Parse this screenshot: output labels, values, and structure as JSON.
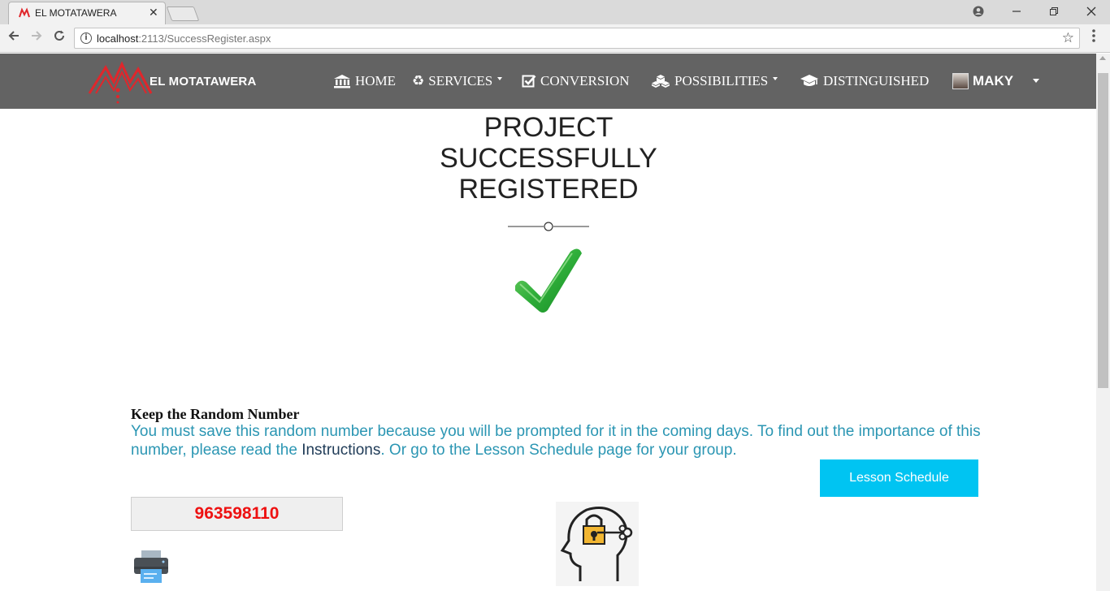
{
  "browser": {
    "tab_title": "EL MOTATAWERA",
    "tab_close": "✕",
    "url_host": "localhost",
    "url_rest": ":2113/SuccessRegister.aspx"
  },
  "navbar": {
    "brand": "EL MOTATAWERA",
    "items": [
      {
        "label": "HOME",
        "icon": "bank-icon"
      },
      {
        "label": "SERVICES",
        "icon": "recycle-icon"
      },
      {
        "label": "CONVERSION",
        "icon": "checkbox-icon"
      },
      {
        "label": "POSSIBILITIES",
        "icon": "cubes-icon"
      },
      {
        "label": "DISTINGUISHED",
        "icon": "graduation-cap-icon"
      }
    ],
    "user": "MAKY"
  },
  "main": {
    "title": "PROJECT SUCCESSFULLY REGISTERED",
    "keep_heading": "Keep the Random Number",
    "message_part1": "You must save this random number because you will be prompted for it in the coming days. To find out the importance of this number, please read the ",
    "message_link": "Instructions",
    "message_part2": ". Or go to the Lesson Schedule page for your group.",
    "lesson_button": "Lesson Schedule",
    "random_number": "963598110"
  },
  "colors": {
    "navbar": "#636363",
    "accent_button": "#00c4f2",
    "message_text": "#2b96b3",
    "random_number": "#ee1111",
    "logo_red": "#e0262b"
  }
}
